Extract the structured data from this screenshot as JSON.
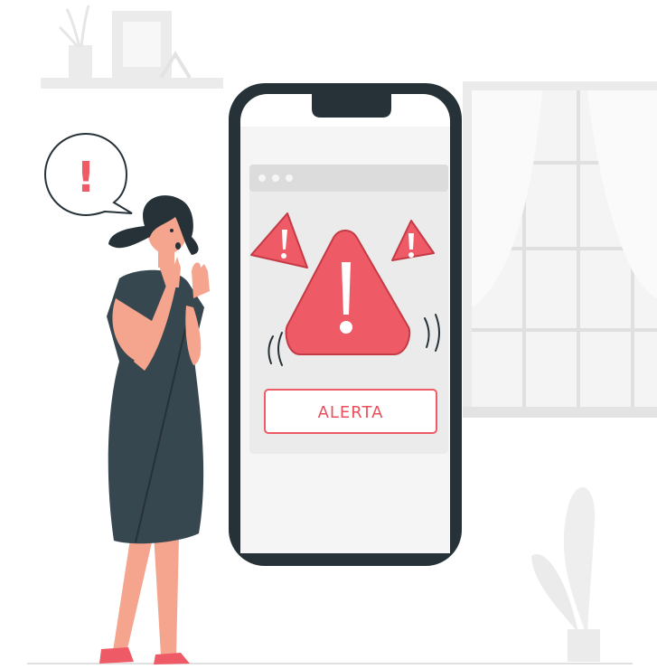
{
  "alert_button": {
    "label": "ALERTA"
  },
  "speech_bubble": {
    "symbol": "!"
  },
  "colors": {
    "accent": "#ee5a66",
    "accent_dark": "#c43b46",
    "phone_frame": "#263238",
    "dress": "#37474f",
    "skin": "#f5a58e",
    "background_gray": "#ebebeb"
  }
}
